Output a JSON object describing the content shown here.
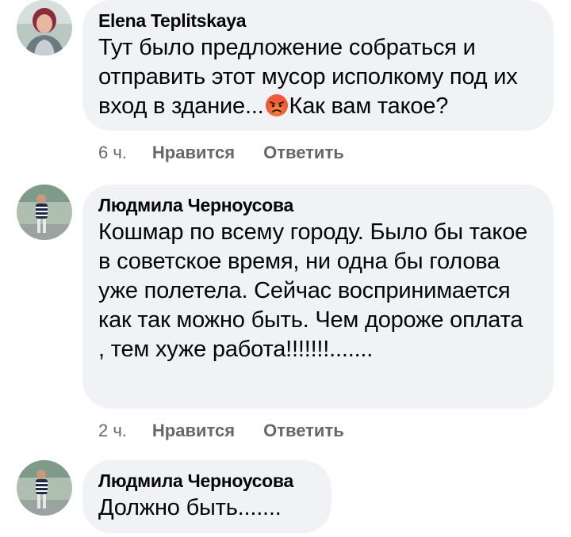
{
  "comments": [
    {
      "author": "Elena Teplitskaya",
      "text_before_emoji": "Тут было предложение собраться и отправить этот мусор исполкому под их вход в здание...",
      "emoji": "angry-face-emoji",
      "text_after_emoji": "Как вам такое?",
      "time": "6 ч.",
      "like_label": "Нравится",
      "reply_label": "Ответить"
    },
    {
      "author": "Людмила Черноусова",
      "text": "Кошмар по всему городу. Было бы такое в советское время, ни одна бы голова уже полетела. Сейчас воспринимается как так можно быть. Чем дороже оплата , тем хуже работа!!!!!!!.......",
      "time": "2 ч.",
      "like_label": "Нравится",
      "reply_label": "Ответить"
    },
    {
      "author": "Людмила Черноусова",
      "text": "Должно быть......."
    }
  ],
  "colors": {
    "bubble": "#f0f2f5",
    "text": "#050505",
    "meta": "#65676b"
  }
}
